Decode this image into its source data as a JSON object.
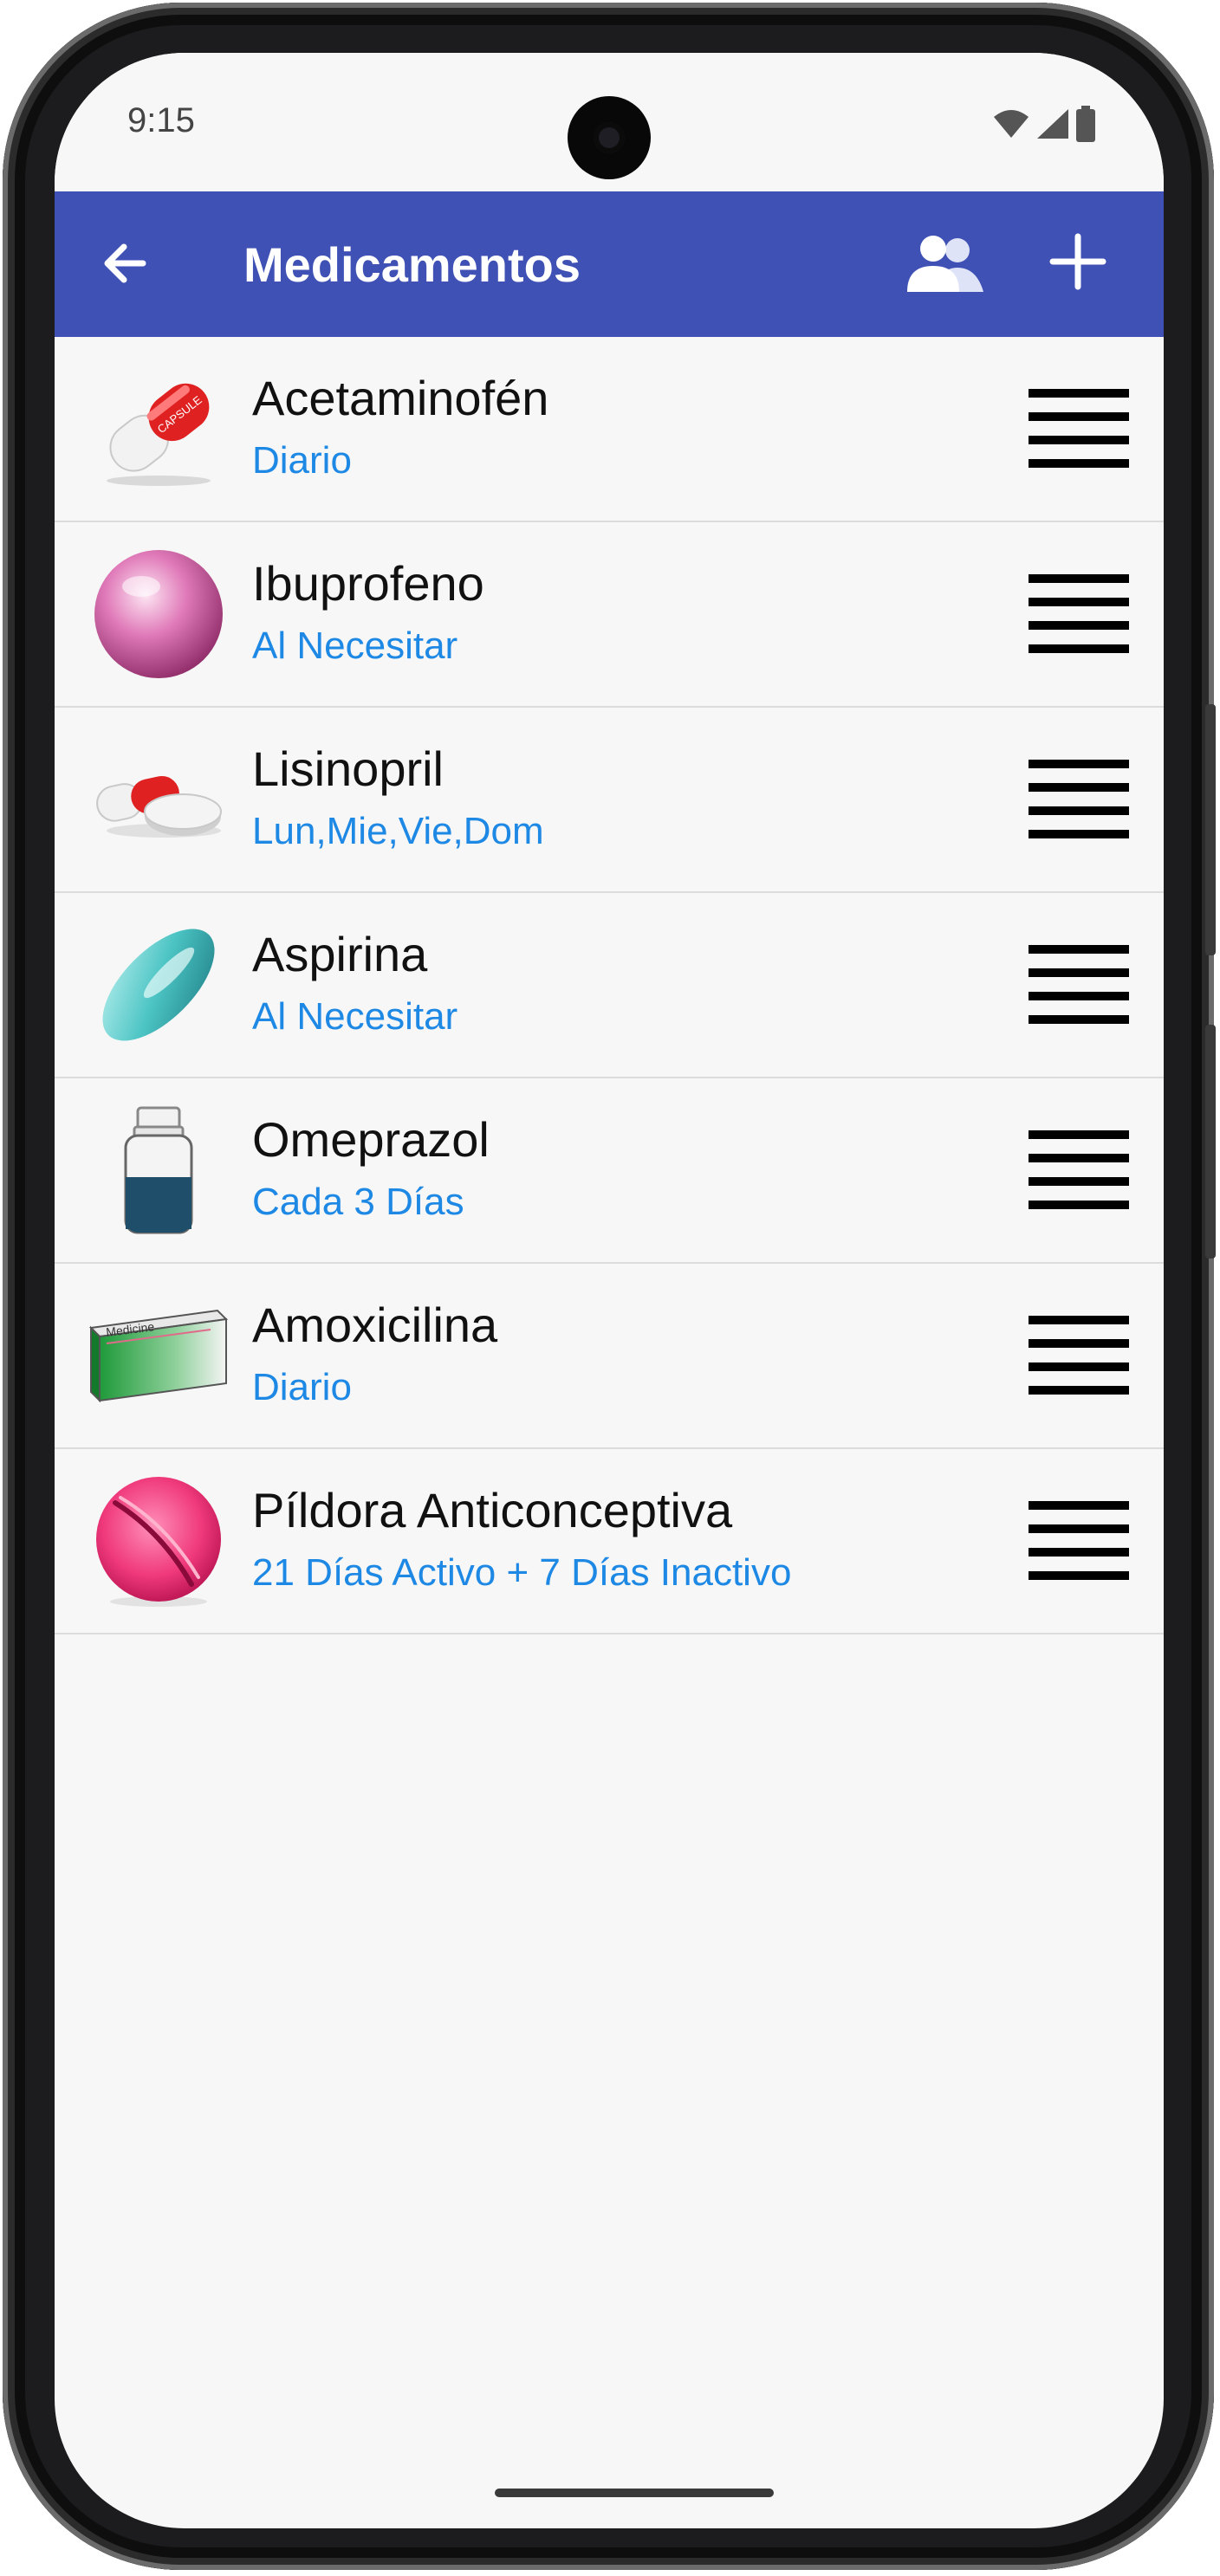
{
  "status_bar": {
    "time": "9:15",
    "icons": [
      "wifi-icon",
      "signal-icon",
      "battery-icon"
    ]
  },
  "app_bar": {
    "title": "Medicamentos",
    "back_icon": "arrow-left-icon",
    "actions": [
      "people-icon",
      "add-icon"
    ],
    "background": "#3f51b5"
  },
  "medications": [
    {
      "name": "Acetaminofén",
      "frequency": "Diario",
      "icon": "capsule-icon"
    },
    {
      "name": "Ibuprofeno",
      "frequency": "Al Necesitar",
      "icon": "pink-pearl-pill-icon"
    },
    {
      "name": "Lisinopril",
      "frequency": "Lun,Mie,Vie,Dom",
      "icon": "capsule-and-tablet-icon"
    },
    {
      "name": "Aspirina",
      "frequency": "Al Necesitar",
      "icon": "teal-oval-pill-icon"
    },
    {
      "name": "Omeprazol",
      "frequency": "Cada 3 Días",
      "icon": "pill-bottle-icon"
    },
    {
      "name": "Amoxicilina",
      "frequency": "Diario",
      "icon": "medicine-box-icon"
    },
    {
      "name": "Píldora Anticonceptiva",
      "frequency": "21 Días Activo + 7 Días Inactivo",
      "icon": "pink-round-pill-icon"
    }
  ],
  "medicine_box_label": "Medicine",
  "capsule_label": "CAPSULE",
  "colors": {
    "frequency_text": "#1e88e5",
    "name_text": "#111111",
    "list_background": "#f7f7f7"
  }
}
